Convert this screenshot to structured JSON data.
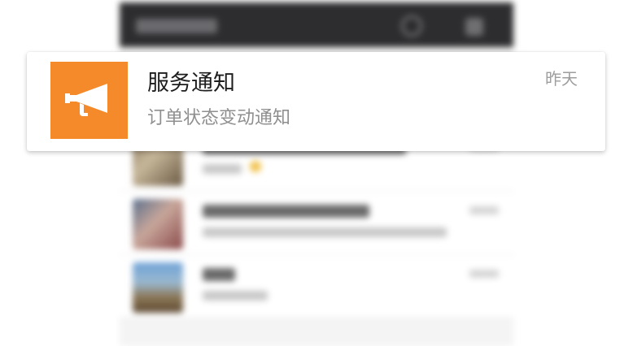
{
  "notification": {
    "app_icon": "megaphone-icon",
    "icon_bg_color": "#f58a2a",
    "title": "服务通知",
    "message": "订单状态变动通知",
    "time": "昨天"
  }
}
